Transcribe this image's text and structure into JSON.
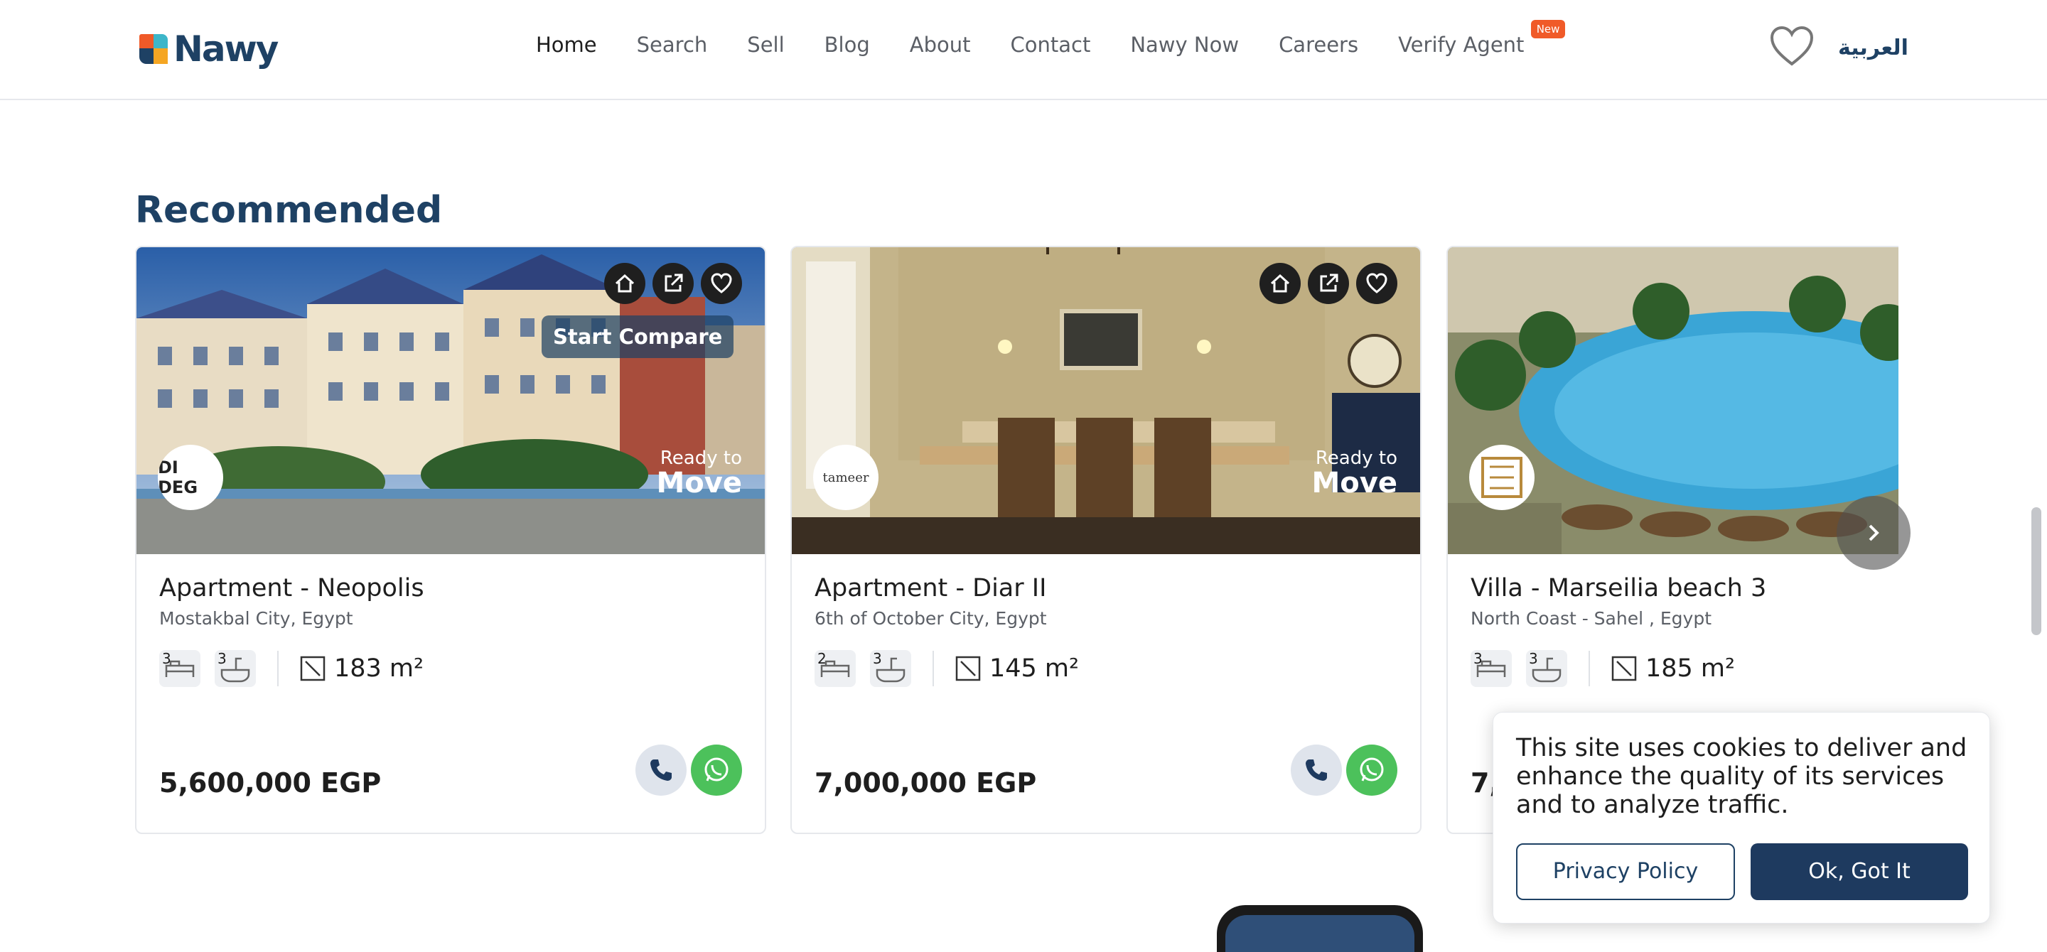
{
  "header": {
    "brand": "Nawy",
    "nav": [
      "Home",
      "Search",
      "Sell",
      "Blog",
      "About",
      "Contact",
      "Nawy Now",
      "Careers",
      "Verify Agent"
    ],
    "new_badge": "New",
    "language": "العربية"
  },
  "section": {
    "title": "Recommended"
  },
  "cards": [
    {
      "title": "Apartment - Neopolis",
      "location": "Mostakbal City, Egypt",
      "beds": "3",
      "baths": "3",
      "area": "183 m²",
      "price": "5,600,000 EGP",
      "ready_top": "Ready to",
      "ready_bottom": "Move",
      "developer": "DI DEG",
      "compare": "Start Compare"
    },
    {
      "title": "Apartment - Diar II",
      "location": "6th of October City, Egypt",
      "beds": "2",
      "baths": "3",
      "area": "145 m²",
      "price": "7,000,000 EGP",
      "ready_top": "Ready to",
      "ready_bottom": "Move",
      "developer": "tameer"
    },
    {
      "title": "Villa - Marseilia beach 3",
      "location": "North Coast - Sahel , Egypt",
      "beds": "3",
      "baths": "3",
      "area": "185 m²",
      "price": "7,"
    }
  ],
  "cookie": {
    "text": "This site uses cookies to deliver and enhance the quality of its services and to analyze traffic.",
    "privacy": "Privacy Policy",
    "ok": "Ok, Got It"
  }
}
